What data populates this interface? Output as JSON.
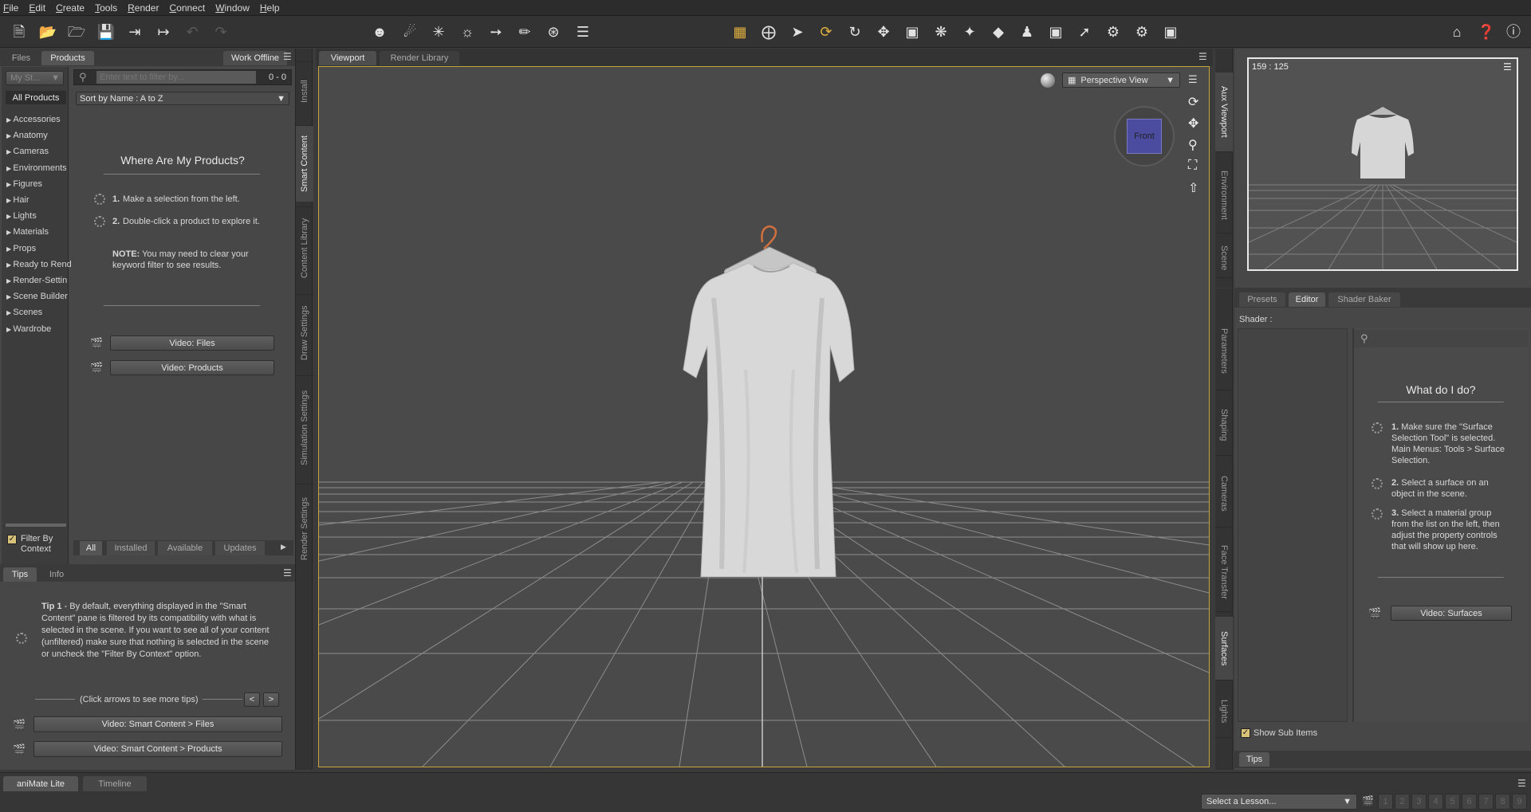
{
  "menu": [
    "File",
    "Edit",
    "Create",
    "Tools",
    "Render",
    "Connect",
    "Window",
    "Help"
  ],
  "left_pane": {
    "tabs": [
      "Files",
      "Products"
    ],
    "active_tab": "Products",
    "work_offline": "Work Offline",
    "my_store": "My St...",
    "filter_placeholder": "Enter text to filter by...",
    "count": "0 - 0",
    "sort": "Sort by Name : A to Z",
    "all_products": "All Products",
    "categories": [
      "Accessories",
      "Anatomy",
      "Cameras",
      "Environments",
      "Figures",
      "Hair",
      "Lights",
      "Materials",
      "Props",
      "Ready to Rend",
      "Render-Settin",
      "Scene Builder",
      "Scenes",
      "Wardrobe"
    ],
    "where_title": "Where Are My Products?",
    "step1_num": "1.",
    "step1": "Make a selection from the left.",
    "step2_num": "2.",
    "step2": "Double-click a product to explore it.",
    "note_label": "NOTE:",
    "note": "You may need to clear your keyword filter to see results.",
    "video_files": "Video: Files",
    "video_products": "Video: Products",
    "filter_by_context": "Filter By Context",
    "bottom_tabs": [
      "All",
      "Installed",
      "Available",
      "Updates"
    ]
  },
  "left_vtabs": [
    "Install",
    "Smart Content",
    "Content Library",
    "Draw Settings",
    "Simulation Settings",
    "Render Settings"
  ],
  "tips_pane": {
    "tabs": [
      "Tips",
      "Info"
    ],
    "tip_label": "Tip 1",
    "tip_text": " - By default, everything displayed in the \"Smart Content\" pane is filtered by its compatibility with what is selected in the scene. If you want to see all of your content (unfiltered) make sure that nothing is selected in the scene or uncheck the \"Filter By Context\" option.",
    "arrows_hint": "(Click arrows to see more tips)",
    "prev": "<",
    "next": ">",
    "video1": "Video: Smart Content > Files",
    "video2": "Video: Smart Content > Products"
  },
  "viewport": {
    "tabs": [
      "Viewport",
      "Render Library"
    ],
    "view_mode": "Perspective View",
    "cube_label": "Front"
  },
  "aux": {
    "ratio": "159 : 125"
  },
  "right_vtabs_top": [
    "Aux Viewport",
    "Environment",
    "Scene"
  ],
  "right_vtabs_bottom": [
    "Parameters",
    "Shaping",
    "Cameras",
    "Face Transfer",
    "Surfaces",
    "Lights"
  ],
  "surfaces": {
    "tabs": [
      "Presets",
      "Editor",
      "Shader Baker"
    ],
    "active_tab": "Editor",
    "shader_label": "Shader :",
    "what_title": "What do I do?",
    "s1_num": "1.",
    "s1": "Make sure the \"Surface Selection Tool\" is selected. Main Menus: Tools > Surface Selection.",
    "s2_num": "2.",
    "s2": "Select a surface on an object in the scene.",
    "s3_num": "3.",
    "s3": "Select a material group from the list on the left, then adjust the property controls that will show up here.",
    "video": "Video: Surfaces",
    "show_sub_items": "Show Sub Items",
    "tips_tab": "Tips"
  },
  "bottom": {
    "tabs": [
      "aniMate Lite",
      "Timeline"
    ],
    "lesson": "Select a Lesson...",
    "pages": [
      "1",
      "2",
      "3",
      "4",
      "5",
      "6",
      "7",
      "8",
      "9"
    ]
  },
  "colors": {
    "accent": "#c8a43c",
    "viewport_bg": "#4a4a4a",
    "panel_bg": "#474747"
  },
  "icons": [
    "new-scene-icon",
    "open-icon",
    "merge-icon",
    "save-icon",
    "import-icon",
    "export-icon",
    "undo-icon",
    "redo-icon",
    "align-icon",
    "figure-icon",
    "spot-light-icon",
    "point-light-icon",
    "distant-light-icon",
    "node-select-icon",
    "region-icon",
    "universal-tool-icon",
    "rotate-icon",
    "translate-icon",
    "scale-icon",
    "joint-editor-icon",
    "geometry-editor-icon",
    "surface-selection-icon",
    "shaping-icon",
    "camera-icon",
    "selection-icon",
    "render-settings-icon",
    "render-icon",
    "spot-render-icon"
  ]
}
